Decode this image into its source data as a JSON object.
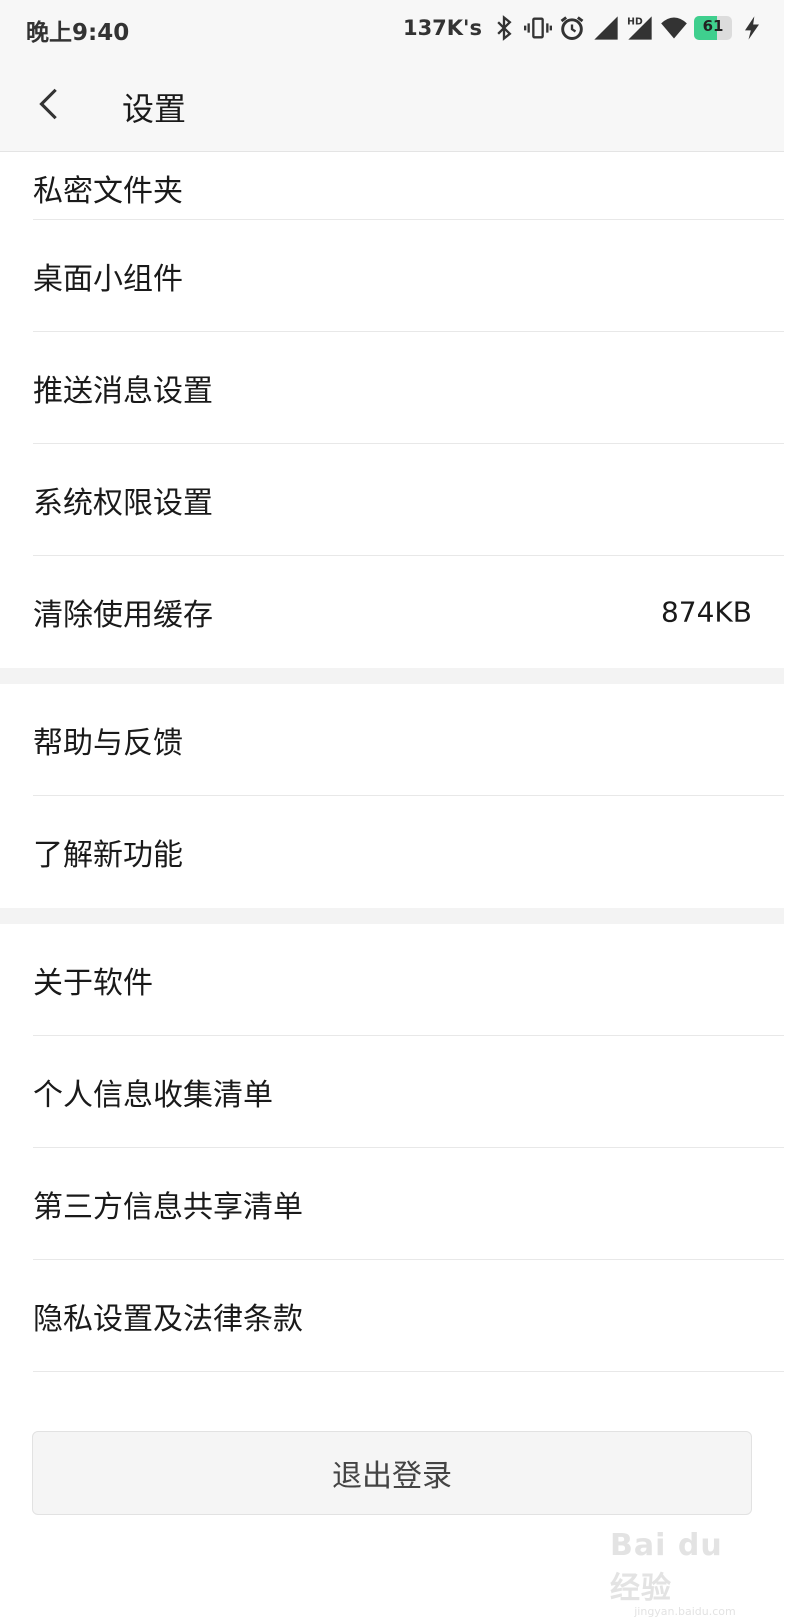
{
  "status_bar": {
    "time": "晚上9:40",
    "net_speed": "137K's",
    "battery_level": "61",
    "battery_fraction": 0.61,
    "icons": [
      "bluetooth-icon",
      "vibrate-icon",
      "alarm-icon",
      "signal-icon",
      "hd-signal-icon",
      "wifi-icon",
      "battery-icon",
      "charging-icon"
    ]
  },
  "header": {
    "title": "设置",
    "back_icon": "chevron-left-icon"
  },
  "sections": [
    {
      "items": [
        {
          "label": "私密文件夹"
        },
        {
          "label": "桌面小组件"
        },
        {
          "label": "推送消息设置"
        },
        {
          "label": "系统权限设置"
        },
        {
          "label": "清除使用缓存",
          "value": "874KB"
        }
      ]
    },
    {
      "items": [
        {
          "label": "帮助与反馈"
        },
        {
          "label": "了解新功能"
        }
      ]
    },
    {
      "items": [
        {
          "label": "关于软件"
        },
        {
          "label": "个人信息收集清单"
        },
        {
          "label": "第三方信息共享清单"
        },
        {
          "label": "隐私设置及法律条款"
        }
      ]
    }
  ],
  "logout": {
    "label": "退出登录"
  },
  "watermark": {
    "logo": "Bai du 经验",
    "url": "jingyan.baidu.com"
  },
  "colors": {
    "battery_fill": "#3fcf8e",
    "background": "#ffffff",
    "bar_background": "#f7f7f7"
  }
}
